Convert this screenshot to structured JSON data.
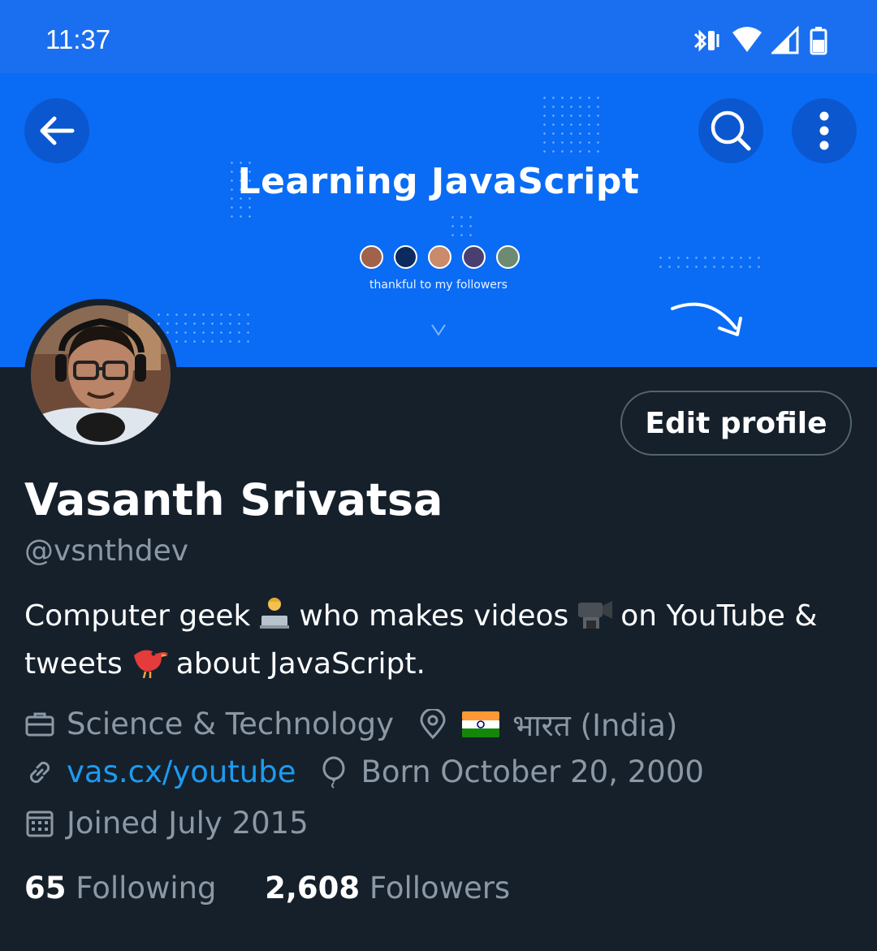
{
  "status_bar": {
    "time": "11:37",
    "icons": [
      "bluetooth-vibrate-icon",
      "wifi-icon",
      "signal-icon",
      "battery-icon"
    ]
  },
  "banner": {
    "title": "Learning JavaScript",
    "subtitle": "thankful to my followers"
  },
  "header_actions": {
    "back": "back-arrow-icon",
    "search": "search-icon",
    "more": "more-vertical-icon"
  },
  "profile": {
    "edit_label": "Edit profile",
    "name": "Vasanth Srivatsa",
    "handle": "@vsnthdev",
    "bio": {
      "part1": "Computer geek",
      "part2": "who makes videos",
      "part3": "on YouTube &",
      "part4": "tweets",
      "part5": "about JavaScript."
    },
    "category": "Science & Technology",
    "location": "भारत (India)",
    "website": "vas.cx/youtube",
    "birthday": "Born October 20, 2000",
    "joined": "Joined July 2015",
    "following_count": "65",
    "following_label": "Following",
    "followers_count": "2,608",
    "followers_label": "Followers"
  },
  "colors": {
    "background": "#15202b",
    "banner": "#0a6cf5",
    "status_bar": "#1a6ff0",
    "link": "#1d9bf0",
    "muted": "#8b98a5"
  }
}
